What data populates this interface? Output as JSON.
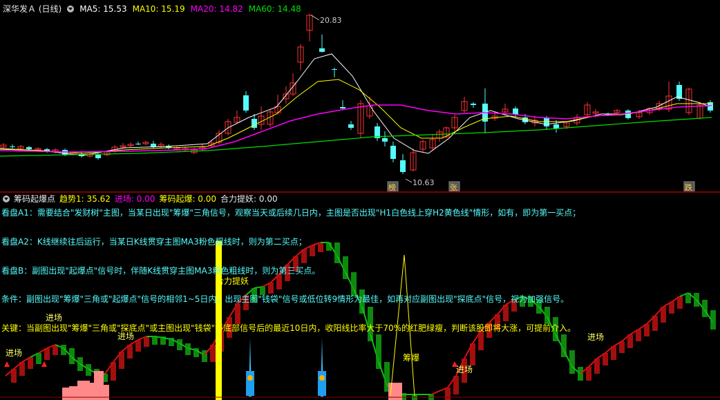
{
  "main": {
    "stock_label": "深华发Ａ (日线)",
    "ma5": "MA5: 15.53",
    "ma10": "MA10: 15.19",
    "ma20": "MA20: 14.82",
    "ma60": "MA60: 14.48",
    "high_label": "20.83",
    "low_label": "10.63",
    "badge_1": "榜",
    "badge_2": "张",
    "badge_3": "跌",
    "colors": {
      "up": "#ff3232",
      "down": "#54fcfc",
      "ma5": "#ffffff",
      "ma10": "#ffff00",
      "ma20": "#ff00ff",
      "ma60": "#00e000"
    }
  },
  "sub": {
    "indicator_name": "筹码起爆点",
    "trend": "趋势1: 35.62",
    "entry": "进场: 0.00",
    "chip_burst": "筹码起爆: 0.00",
    "hehe": "合力提妖: 0.00",
    "notes": [
      "看盘A1：需要结合\"发财树\"主图，当某日出现\"筹爆\"三角信号，观察当天或后续几日内，主图是否出现\"H1白色线上穿H2黄色线\"情形，如有，即为第一买点；",
      "看盘A2：K线继续往后运行，当某日K线贯穿主图MA3粉色粗线时，则为第二买点；",
      "看盘B：副图出现\"起爆点\"信号时，伴随K线贯穿主图MA3粉色粗线时，则为第三买点。",
      "条件：副图出现\"筹爆\"三角或\"起爆点\"信号的相邻1~5日内，出现主图\"钱袋\"信号或低位转9情形为最佳，如再对应副图出现\"探底点\"信号，视为加强信号。",
      "关键：当副图出现\"筹爆\"三角或\"探底点\"或主图出现\"钱袋\"等底部信号后的最近10日内，收阳线比率大于70%的红肥绿瘦，判断该股即将大涨，可提前介入。"
    ],
    "labels": {
      "jinchang": "进场",
      "chou_bao": "筹爆",
      "he_li_ti_yao": "合力提妖"
    }
  }
}
